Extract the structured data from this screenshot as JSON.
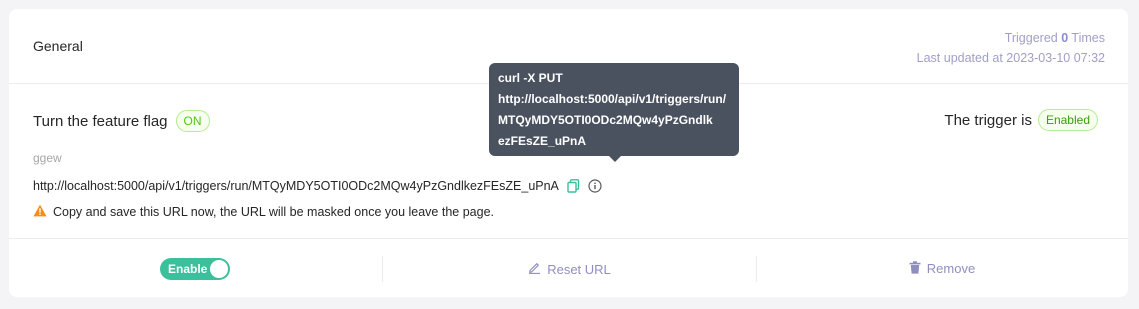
{
  "header": {
    "title": "General",
    "triggered_prefix": "Triggered",
    "triggered_count": "0",
    "triggered_suffix": "Times",
    "last_updated": "Last updated at 2023-03-10 07:32"
  },
  "flag": {
    "label": "Turn the feature flag",
    "state_tag": "ON",
    "description": "ggew"
  },
  "trigger": {
    "label": "The trigger is",
    "status_tag": "Enabled"
  },
  "url": {
    "value": "http://localhost:5000/api/v1/triggers/run/MTQyMDY5OTI0ODc2MQw4yPzGndlkezFEsZE_uPnA",
    "warning": "Copy and save this URL now, the URL will be masked once you leave the page."
  },
  "tooltip": {
    "lines": [
      "curl -X PUT",
      "http://localhost:5000/api/v1/triggers/run/",
      "MTQyMDY5OTI0ODc2MQw4yPzGndlk",
      "ezFEsZE_uPnA"
    ]
  },
  "footer": {
    "toggle_label": "Enable",
    "reset_label": "Reset URL",
    "remove_label": "Remove"
  },
  "colors": {
    "accent_green": "#3ac09b",
    "muted_purple": "#8f8fbf",
    "tooltip_bg": "#4a5260",
    "warning_orange": "#fa8c16"
  },
  "icons": [
    "copy-icon",
    "info-icon",
    "warning-icon",
    "edit-icon",
    "trash-icon"
  ]
}
